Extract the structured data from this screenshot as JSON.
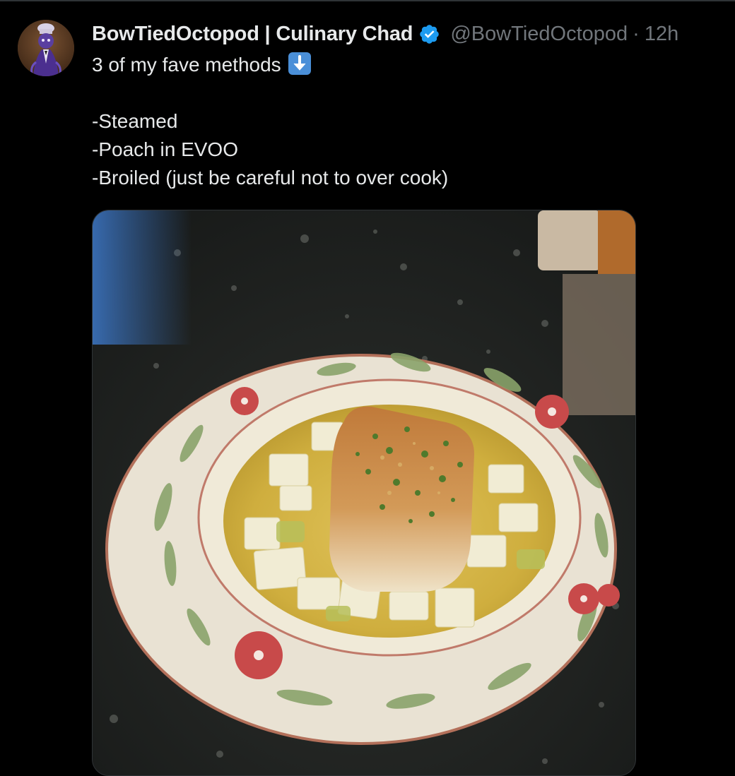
{
  "tweet": {
    "display_name": "BowTiedOctopod | Culinary Chad",
    "handle": "@BowTiedOctopod",
    "separator": "·",
    "time": "12h",
    "text_line1": "3 of my fave methods",
    "text_line2": "-Steamed",
    "text_line3": "-Poach in EVOO",
    "text_line4": "-Broiled (just be careful not to over cook)",
    "icons": {
      "avatar": "octopod-chef-avatar-icon",
      "verified": "verified-badge-icon",
      "emoji": "down-arrow-emoji-icon"
    },
    "colors": {
      "background": "#000000",
      "text": "#e7e9ea",
      "muted": "#71767b",
      "verified": "#1d9bf0",
      "emoji_bg": "#4a8fd8"
    }
  }
}
